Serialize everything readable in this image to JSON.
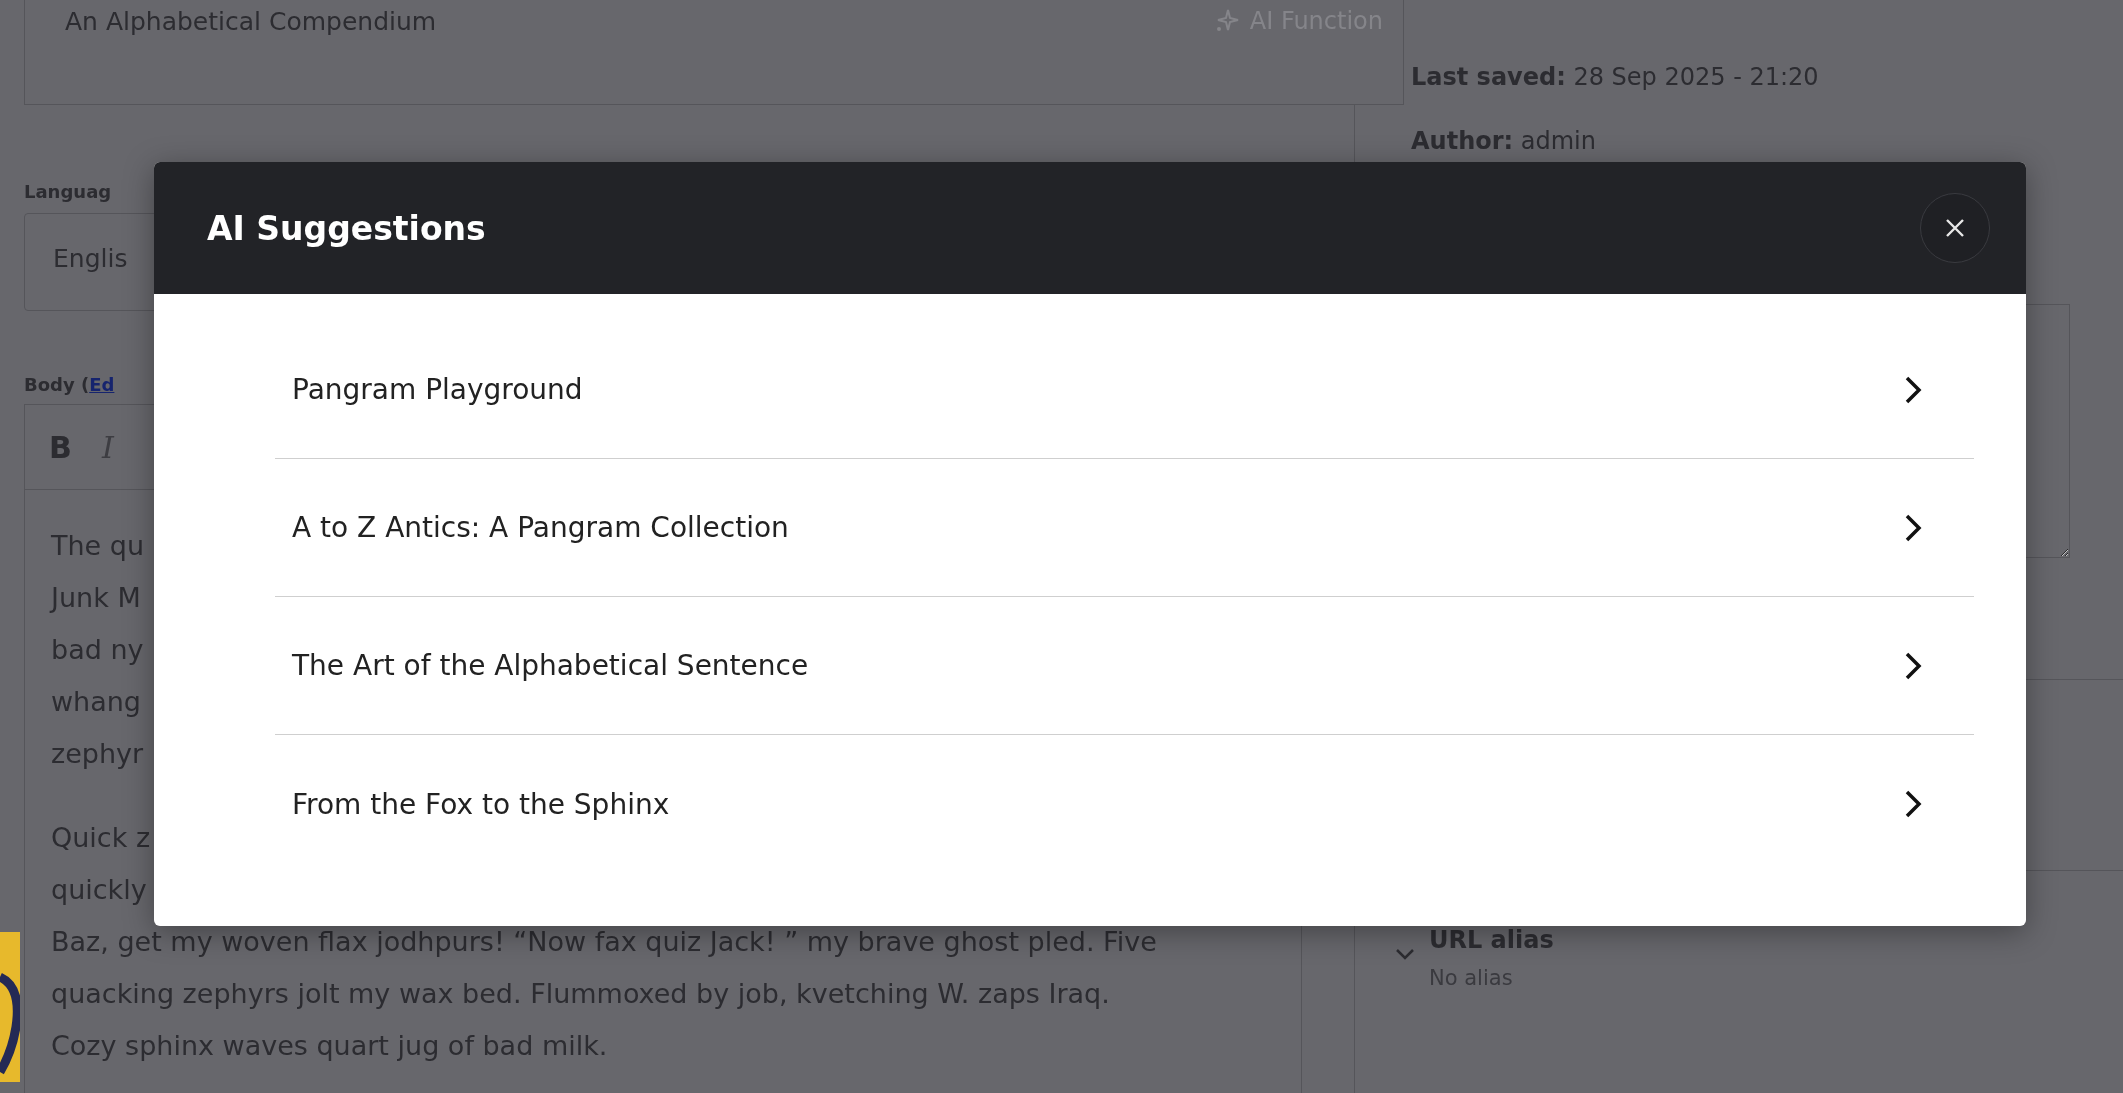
{
  "title_field": {
    "value": "An Alphabetical Compendium",
    "ai_button": "AI Function"
  },
  "language": {
    "label": "Languag",
    "value": "Englis"
  },
  "body": {
    "label": "Body (",
    "link": "Ed",
    "toolbar": [
      {
        "label": "B",
        "kind": "bold"
      },
      {
        "label": "I",
        "kind": "italic"
      }
    ],
    "paragraphs": [
      [
        "The qu",
        "Junk M",
        "bad ny",
        "whang",
        "zephyr"
      ],
      [
        "Quick z",
        "quickly",
        "Baz, get my woven flax jodhpurs! “Now fax quiz Jack! ” my brave ghost pled. Five",
        "quacking zephyrs jolt my wax bed. Flummoxed by job, kvetching W. zaps Iraq.",
        "Cozy sphinx waves quart jug of bad milk."
      ]
    ]
  },
  "meta": [
    {
      "label": "Last saved:",
      "value": "28 Sep 2025 - 21:20"
    },
    {
      "label": "Author:",
      "value": "admin"
    }
  ],
  "url_alias": {
    "title": "URL alias",
    "summary": "No alias"
  },
  "modal": {
    "title": "AI Suggestions",
    "suggestions": [
      "Pangram Playground",
      "A to Z Antics: A Pangram Collection",
      "The Art of the Alphabetical Sentence",
      "From the Fox to the Sphinx"
    ]
  }
}
